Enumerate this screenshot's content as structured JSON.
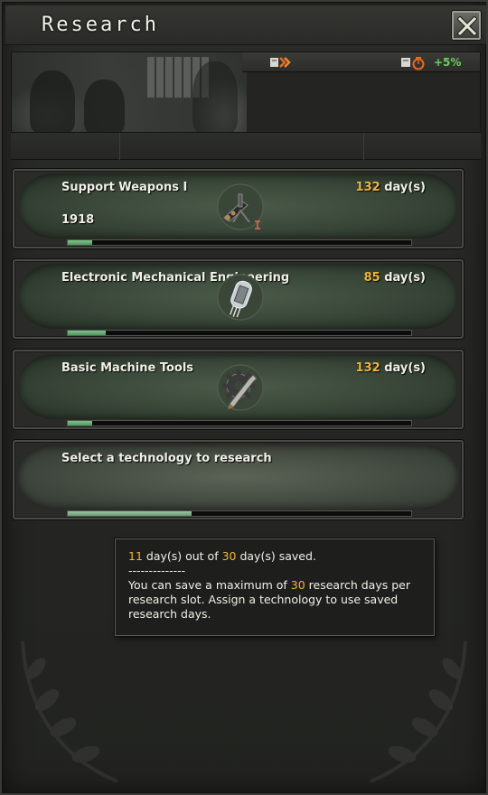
{
  "window": {
    "title": "Research",
    "close_label": "close"
  },
  "banner": {
    "speed_icon": "research-speed-icon",
    "bonus_icon": "research-bonus-icon",
    "bonus_text": "+5%"
  },
  "slots": [
    {
      "name": "Support Weapons I",
      "year": "1918",
      "days_num": "132",
      "days_unit": "day(s)",
      "icon": "support-weapons-icon",
      "progress": 0.07
    },
    {
      "name": "Electronic Mechanical Engineering",
      "year": "",
      "days_num": "85",
      "days_unit": "day(s)",
      "icon": "vacuum-tube-icon",
      "progress": 0.11
    },
    {
      "name": "Basic Machine Tools",
      "year": "",
      "days_num": "132",
      "days_unit": "day(s)",
      "icon": "machine-tools-icon",
      "progress": 0.07
    },
    {
      "name": "Select a technology to research",
      "year": "",
      "days_num": "",
      "days_unit": "",
      "icon": "",
      "progress": 0.36
    }
  ],
  "tooltip": {
    "saved_num": "11",
    "saved_mid": " day(s) out of ",
    "max_num": "30",
    "saved_end": " day(s) saved.",
    "separator": "--------------",
    "line2_start": "You can save a maximum of ",
    "line2_num": "30",
    "line2_end": " research days per research slot. Assign a technology to use saved research days."
  },
  "colors": {
    "accent_orange": "#f0b43c",
    "bonus_green": "#6fcf5d",
    "progress_green": "#5fae6f"
  }
}
